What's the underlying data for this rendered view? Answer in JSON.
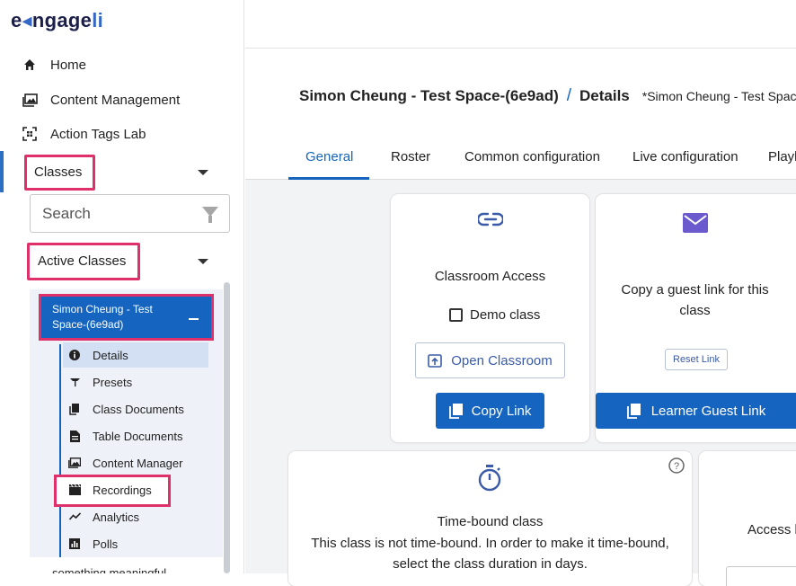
{
  "brand": {
    "logo_pre": "e",
    "logo_mid": "ngage",
    "logo_post": "li"
  },
  "sidebar": {
    "nav": [
      {
        "label": "Home",
        "icon": "home-icon"
      },
      {
        "label": "Content Management",
        "icon": "images-icon"
      },
      {
        "label": "Action Tags Lab",
        "icon": "qr-scan-icon"
      }
    ],
    "classes_label": "Classes",
    "search_placeholder": "Search",
    "active_classes_label": "Active Classes",
    "class_name": "Simon Cheung - Test Space-(6e9ad)",
    "sub_items": [
      {
        "label": "Details",
        "icon": "info-icon"
      },
      {
        "label": "Presets",
        "icon": "camera-icon"
      },
      {
        "label": "Class Documents",
        "icon": "copy-docs-icon"
      },
      {
        "label": "Table Documents",
        "icon": "document-icon"
      },
      {
        "label": "Content Manager",
        "icon": "images-icon"
      },
      {
        "label": "Recordings",
        "icon": "clapperboard-icon"
      },
      {
        "label": "Analytics",
        "icon": "trend-line-icon"
      },
      {
        "label": "Polls",
        "icon": "bar-chart-icon"
      }
    ],
    "bottom_text": "something meaningful"
  },
  "header": {
    "breadcrumb_space": "Simon Cheung - Test Space-(6e9ad)",
    "breadcrumb_sep": "/",
    "breadcrumb_page": "Details",
    "subtitle": "*Simon Cheung - Test Space*"
  },
  "tabs": [
    "General",
    "Roster",
    "Common configuration",
    "Live configuration",
    "Playl"
  ],
  "cards": {
    "classroom": {
      "icon": "link-icon",
      "title": "Classroom Access",
      "checkbox_label": "Demo class",
      "open_label": "Open Classroom",
      "copy_label": "Copy Link"
    },
    "guest": {
      "icon": "mail-icon",
      "title": "Copy a guest link for this class",
      "reset_label": "Reset Link",
      "learner_label": "Learner Guest Link"
    },
    "timebound": {
      "icon": "stopwatch-icon",
      "help_icon": "help-icon",
      "title": "Time-bound class",
      "body": "This class is not time-bound. In order to make it time-bound, select the class duration in days."
    },
    "access": {
      "title": "Access b"
    }
  },
  "colors": {
    "primary": "#1565c0",
    "highlight": "#e0306a",
    "panel": "#eef1f7"
  }
}
